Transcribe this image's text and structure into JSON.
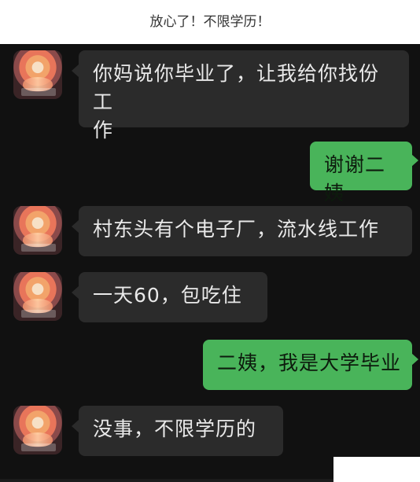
{
  "header": {
    "caption": "放心了！不限学历！"
  },
  "messages": [
    {
      "side": "left",
      "text": "你妈说你毕业了，让我给你找份工\n作"
    },
    {
      "side": "right",
      "text": "谢谢二姨"
    },
    {
      "side": "left",
      "text": "村东头有个电子厂，流水线工作"
    },
    {
      "side": "left",
      "text": "一天60，包吃住"
    },
    {
      "side": "right",
      "text": "二姨，我是大学毕业"
    },
    {
      "side": "left",
      "text": "没事，不限学历的"
    }
  ],
  "colors": {
    "chat_background": "#111111",
    "incoming_bubble": "#2b2b2b",
    "outgoing_bubble": "#49b45a"
  },
  "icons": {
    "avatar": "lotus-avatar-icon"
  }
}
